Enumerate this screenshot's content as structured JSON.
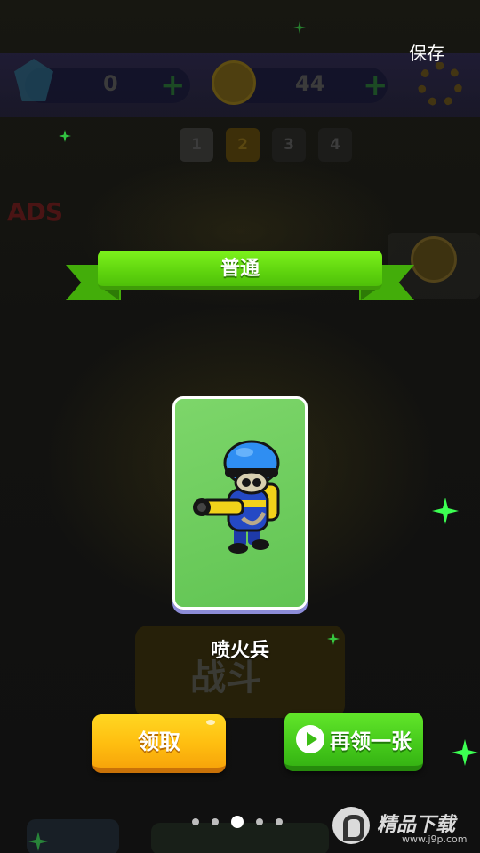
{
  "header": {
    "save_label": "保存"
  },
  "background": {
    "gems_value": "0",
    "coins_value": "44",
    "plus_symbol": "+",
    "level_tabs": [
      "1",
      "2",
      "3",
      "4"
    ],
    "active_level_tab": "2",
    "ads_logo_text": "ADS",
    "fight_label": "战斗"
  },
  "reward": {
    "rarity_label": "普通",
    "unit_name": "喷火兵",
    "card_icon": "flamethrower-soldier-icon"
  },
  "actions": {
    "claim_label": "领取",
    "claim_again_label": "再领一张",
    "claim_again_icon": "video-play-icon"
  },
  "pagination": {
    "total": 5,
    "current": 3
  },
  "watermark": {
    "brand": "精品下载",
    "url": "www.j9p.com"
  },
  "colors": {
    "rarity_green": "#5fd40e",
    "claim_yellow": "#ffbe10",
    "claim_again_green": "#45c91b",
    "card_green": "#6ccc5c",
    "sparkle_green": "#3cff52"
  }
}
